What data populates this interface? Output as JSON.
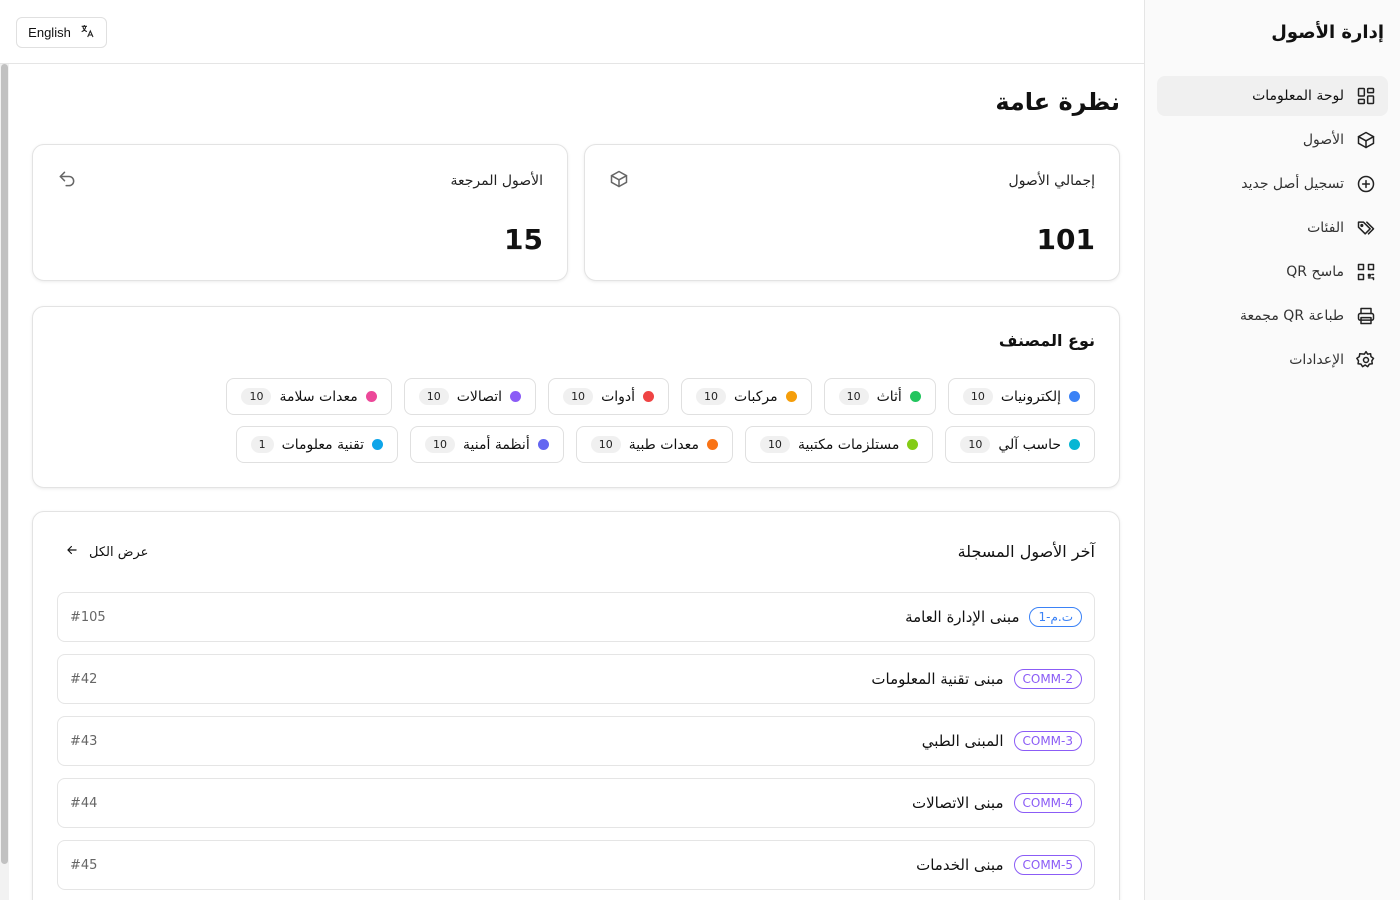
{
  "app": {
    "title": "إدارة الأصول"
  },
  "header": {
    "language_label": "English"
  },
  "sidebar": {
    "items": [
      {
        "label": "لوحة المعلومات",
        "icon": "dashboard-icon",
        "active": true
      },
      {
        "label": "الأصول",
        "icon": "box-icon",
        "active": false
      },
      {
        "label": "تسجيل أصل جديد",
        "icon": "plus-circle-icon",
        "active": false
      },
      {
        "label": "الفئات",
        "icon": "tags-icon",
        "active": false
      },
      {
        "label": "ماسح QR",
        "icon": "qr-code-icon",
        "active": false
      },
      {
        "label": "طباعة QR مجمعة",
        "icon": "printer-icon",
        "active": false
      },
      {
        "label": "الإعدادات",
        "icon": "gear-icon",
        "active": false
      }
    ]
  },
  "main": {
    "title": "نظرة عامة",
    "stats": [
      {
        "label": "إجمالي الأصول",
        "value": "101",
        "icon": "box-icon"
      },
      {
        "label": "الأصول المرجعة",
        "value": "15",
        "icon": "undo-icon"
      }
    ],
    "categories": {
      "title": "نوع المصنف",
      "row1": [
        {
          "name": "إلكترونيات",
          "count": "10",
          "color": "#3b82f6"
        },
        {
          "name": "أثاث",
          "count": "10",
          "color": "#22c55e"
        },
        {
          "name": "مركبات",
          "count": "10",
          "color": "#f59e0b"
        },
        {
          "name": "أدوات",
          "count": "10",
          "color": "#ef4444"
        },
        {
          "name": "اتصالات",
          "count": "10",
          "color": "#8b5cf6"
        },
        {
          "name": "معدات سلامة",
          "count": "10",
          "color": "#ec4899"
        }
      ],
      "row2": [
        {
          "name": "حاسب آلي",
          "count": "10",
          "color": "#06b6d4"
        },
        {
          "name": "مستلزمات مكتبية",
          "count": "10",
          "color": "#84cc16"
        },
        {
          "name": "معدات طبية",
          "count": "10",
          "color": "#f97316"
        },
        {
          "name": "أنظمة أمنية",
          "count": "10",
          "color": "#6366f1"
        },
        {
          "name": "تقنية معلومات",
          "count": "1",
          "color": "#0ea5e9"
        }
      ]
    },
    "recent": {
      "title": "آخر الأصول المسجلة",
      "view_all": "عرض الكل",
      "rows": [
        {
          "tag": "ت.م-1",
          "tag_color": "#3b82f6",
          "name": "مبنى الإدارة العامة",
          "id": "#105"
        },
        {
          "tag": "COMM-2",
          "tag_color": "#8b5cf6",
          "name": "مبنى تقنية المعلومات",
          "id": "#42"
        },
        {
          "tag": "COMM-3",
          "tag_color": "#8b5cf6",
          "name": "المبنى الطبي",
          "id": "#43"
        },
        {
          "tag": "COMM-4",
          "tag_color": "#8b5cf6",
          "name": "مبنى الاتصالات",
          "id": "#44"
        },
        {
          "tag": "COMM-5",
          "tag_color": "#8b5cf6",
          "name": "مبنى الخدمات",
          "id": "#45"
        }
      ]
    }
  }
}
